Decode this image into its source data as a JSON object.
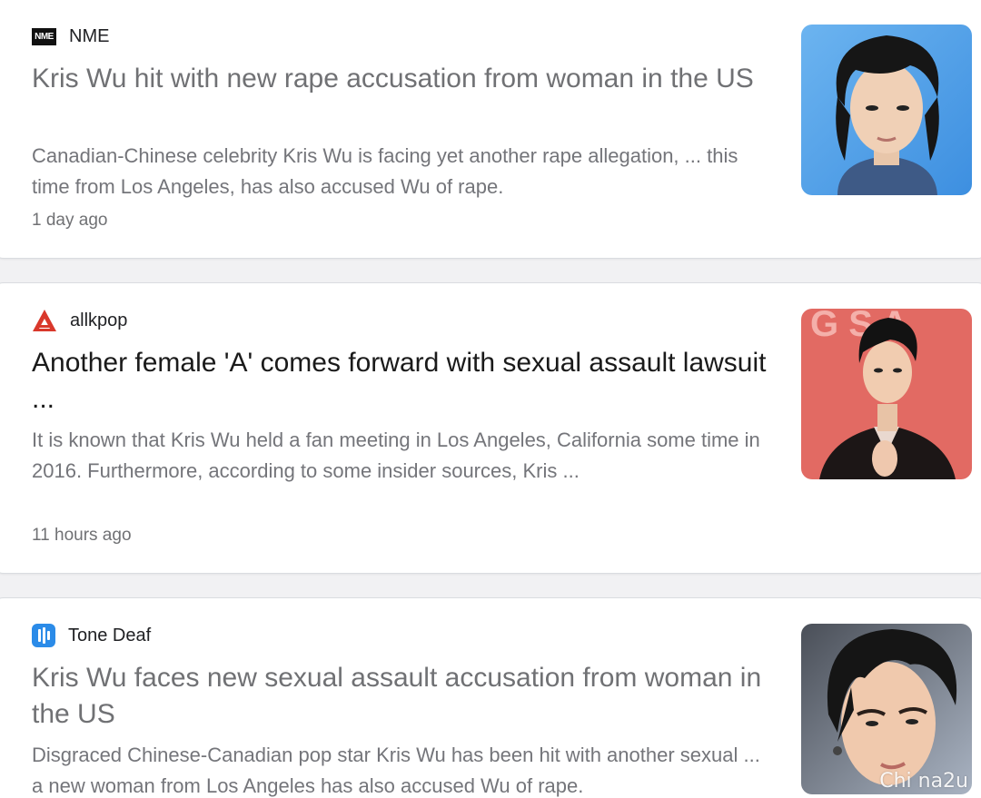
{
  "articles": [
    {
      "source": "NME",
      "source_icon": "nme-logo-icon",
      "headline": "Kris Wu hit with new rape accusation from woman in the US",
      "snippet": "Canadian-Chinese celebrity Kris Wu is facing yet another rape allegation, ... this time from Los Angeles, has also accused Wu of rape.",
      "time": "1 day ago",
      "thumbnail": "portrait-photo"
    },
    {
      "source": "allkpop",
      "source_icon": "allkpop-logo-icon",
      "headline": "Another female 'A' comes forward with sexual assault lawsuit ...",
      "snippet": "It is known that Kris Wu held a fan meeting in Los Angeles, California some time in 2016. Furthermore, according to some insider sources, Kris ...",
      "time": "11 hours ago",
      "thumbnail": "event-photo"
    },
    {
      "source": "Tone Deaf",
      "source_icon": "tonedeaf-logo-icon",
      "headline": "Kris Wu faces new sexual assault accusation from woman in the US",
      "snippet": "Disgraced Chinese-Canadian pop star Kris Wu has been hit with another sexual ... a new woman from Los Angeles has also accused Wu of rape.",
      "time": "",
      "thumbnail": "performance-photo"
    }
  ],
  "watermark": "Chi na2u",
  "colors": {
    "headline_visited": "#707174",
    "headline_unvisited": "#1a1a1a",
    "allkpop_red": "#d9382b",
    "tonedeaf_blue": "#2b8be8"
  }
}
